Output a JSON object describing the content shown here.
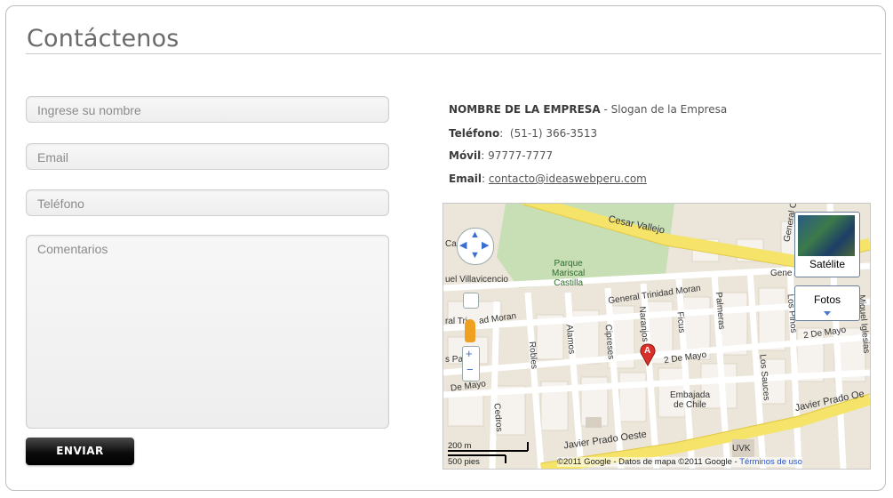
{
  "page": {
    "title": "Contáctenos"
  },
  "form": {
    "name_placeholder": "Ingrese su nombre",
    "email_placeholder": "Email",
    "phone_placeholder": "Teléfono",
    "comments_placeholder": "Comentarios",
    "submit_label": "ENVIAR"
  },
  "company": {
    "name": "NOMBRE DE LA EMPRESA",
    "separator": " - ",
    "slogan": "Slogan de la Empresa",
    "phone_label": "Teléfono",
    "phone_value": "(51-1) 366-3513",
    "mobile_label": "Móvil",
    "mobile_value": "97777-7777",
    "email_label": "Email",
    "email_value": "contacto@ideaswebperu.com"
  },
  "map": {
    "streets": {
      "cesar_vallejo": "Cesar Vallejo",
      "villavicencio": "uel Villavicencio",
      "parque": "Parque",
      "mariscal": "Mariscal",
      "castilla": "Castilla",
      "trinidad_moran": "General Trinidad Moran",
      "trinidad_left": "ral Tri",
      "moran_left": "ad Moran",
      "alamos": "Alamos",
      "cipreses": "Cipreses",
      "naranjos": "Naranjos",
      "ficus": "Ficus",
      "palmeras": "Palmeras",
      "los_pinos": "Los Pinos",
      "de_mayo_right": "2 De Mayo",
      "de_mayo_mid": "2 De Mayo",
      "miguel_iglesias": "Miguel Iglesias",
      "robles": "Robles",
      "pas": "s Pas",
      "de_mayo_left": "De Mayo",
      "los_sauces": "Los Sauces",
      "cedros": "Cedros",
      "embajada": "Embajada",
      "de_chile": "de Chile",
      "prado_right": "Javier Prado Oe",
      "prado_bottom": "Javier Prado Oeste",
      "uvk": "UVK",
      "general_top": "General C",
      "gene": "Gene",
      "ca": "Ca"
    },
    "marker": "A",
    "satellite_label": "Satélite",
    "photos_label": "Fotos",
    "scale_m": "200 m",
    "scale_ft": "500 pies",
    "copyright": "©2011 Google - Datos de mapa ©2011 Google -",
    "terms": "Términos de uso"
  }
}
